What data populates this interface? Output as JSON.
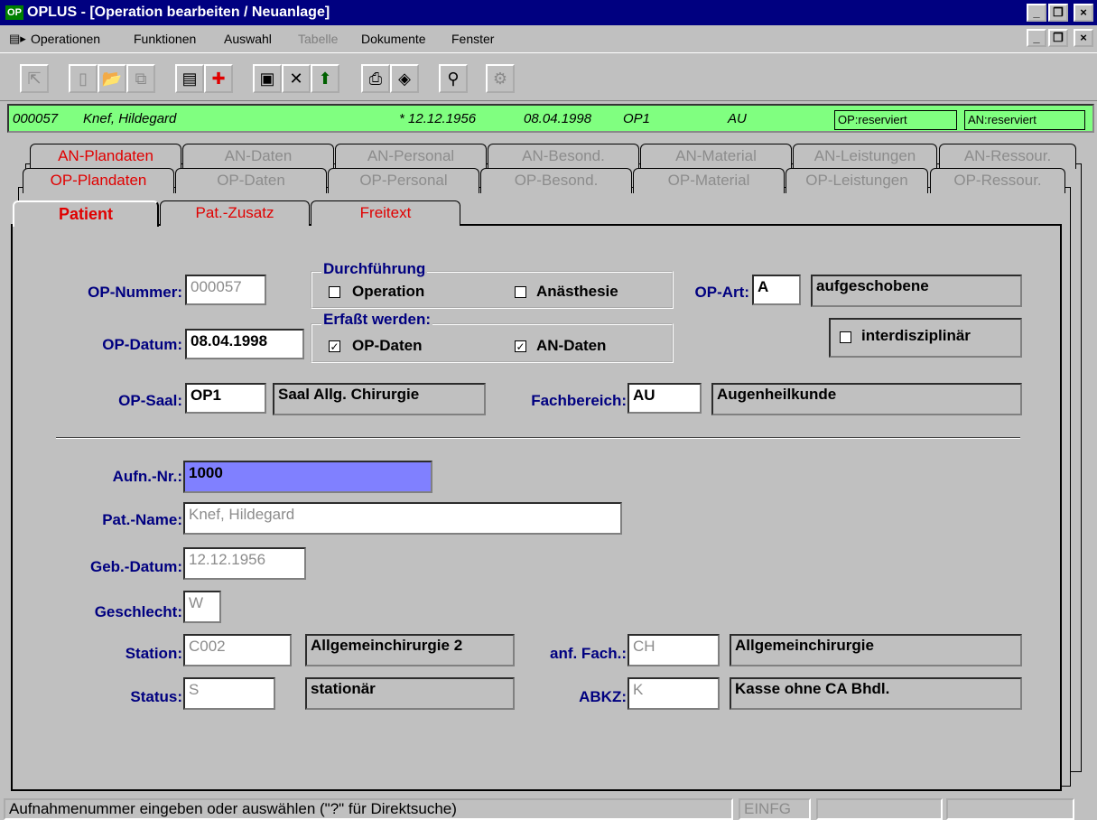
{
  "window": {
    "app_icon_text": "OP",
    "title": "OPLUS - [Operation bearbeiten / Neuanlage]",
    "min": "_",
    "max": " ",
    "close": "×"
  },
  "menu": {
    "items": [
      {
        "label": "Operationen",
        "enabled": true
      },
      {
        "label": "Funktionen",
        "enabled": true
      },
      {
        "label": "Auswahl",
        "enabled": true
      },
      {
        "label": "Tabelle",
        "enabled": false
      },
      {
        "label": "Dokumente",
        "enabled": true
      },
      {
        "label": "Fenster",
        "enabled": true
      }
    ]
  },
  "toolbar": {
    "buttons": [
      {
        "icon": "exit-icon",
        "glyph": "⇱",
        "enabled": false
      },
      {
        "icon": "new-doc-icon",
        "glyph": "▯",
        "enabled": false
      },
      {
        "icon": "open-folder-icon",
        "glyph": "📂",
        "enabled": false
      },
      {
        "icon": "copy-icon",
        "glyph": "⧉",
        "enabled": false
      },
      {
        "icon": "list-icon",
        "glyph": "▤",
        "enabled": true
      },
      {
        "icon": "add-icon",
        "glyph": "✚",
        "enabled": true
      },
      {
        "icon": "save-icon",
        "glyph": "▣",
        "enabled": true
      },
      {
        "icon": "delete-icon",
        "glyph": "✕",
        "enabled": true
      },
      {
        "icon": "up-arrow-icon",
        "glyph": "⬆",
        "enabled": true
      },
      {
        "icon": "print-icon",
        "glyph": "⎙",
        "enabled": true
      },
      {
        "icon": "tag-icon",
        "glyph": "◈",
        "enabled": true
      },
      {
        "icon": "binoculars-icon",
        "glyph": "⚲",
        "enabled": true
      },
      {
        "icon": "tools-icon",
        "glyph": "⚙",
        "enabled": false
      }
    ]
  },
  "patient_bar": {
    "number": "000057",
    "name": "Knef, Hildegard",
    "birth": "* 12.12.1956",
    "op_date": "08.04.1998",
    "room": "OP1",
    "dept": "AU",
    "op_status": "OP:reserviert",
    "an_status": "AN:reserviert"
  },
  "tabs": {
    "an_row": [
      "AN-Plandaten",
      "AN-Daten",
      "AN-Personal",
      "AN-Besond.",
      "AN-Material",
      "AN-Leistungen",
      "AN-Ressour."
    ],
    "op_row": [
      "OP-Plandaten",
      "OP-Daten",
      "OP-Personal",
      "OP-Besond.",
      "OP-Material",
      "OP-Leistungen",
      "OP-Ressour."
    ],
    "patient_row": [
      "Patient",
      "Pat.-Zusatz",
      "Freitext"
    ]
  },
  "form": {
    "op_nummer_label": "OP-Nummer:",
    "op_nummer": "000057",
    "durchfuehrung_title": "Durchführung",
    "operation_label": "Operation",
    "operation_checked": false,
    "anaesthesie_label": "Anästhesie",
    "anaesthesie_checked": false,
    "op_art_label": "OP-Art:",
    "op_art": "A",
    "op_art_text": "aufgeschobene",
    "op_datum_label": "OP-Datum:",
    "op_datum": "08.04.1998",
    "erfasst_title": "Erfaßt werden:",
    "op_daten_label": "OP-Daten",
    "op_daten_checked": true,
    "an_daten_label": "AN-Daten",
    "an_daten_checked": true,
    "interdisziplinaer_label": "interdisziplinär",
    "interdisziplinaer_checked": false,
    "op_saal_label": "OP-Saal:",
    "op_saal": "OP1",
    "op_saal_text": "Saal Allg. Chirurgie",
    "fachbereich_label": "Fachbereich:",
    "fachbereich": "AU",
    "fachbereich_text": "Augenheilkunde",
    "aufn_nr_label": "Aufn.-Nr.:",
    "aufn_nr": "1000",
    "pat_name_label": "Pat.-Name:",
    "pat_name": "Knef, Hildegard",
    "geb_datum_label": "Geb.-Datum:",
    "geb_datum": "12.12.1956",
    "geschlecht_label": "Geschlecht:",
    "geschlecht": "W",
    "station_label": "Station:",
    "station": "C002",
    "station_text": "Allgemeinchirurgie 2",
    "anf_fach_label": "anf. Fach.:",
    "anf_fach": "CH",
    "anf_fach_text": "Allgemeinchirurgie",
    "status_label": "Status:",
    "status": "S",
    "status_text": "stationär",
    "abkz_label": "ABKZ:",
    "abkz": "K",
    "abkz_text": "Kasse ohne CA Bhdl."
  },
  "statusbar": {
    "message": "Aufnahmenummer eingeben oder auswählen (\"?\" für Direktsuche)",
    "mode": "EINFG",
    "panel3": "",
    "panel4": ""
  },
  "colors": {
    "title_bg": "#000080",
    "patient_bar_bg": "#80ff80",
    "label_color": "#000080",
    "active_tab_text": "#e00000",
    "selected_field_bg": "#8080ff"
  }
}
